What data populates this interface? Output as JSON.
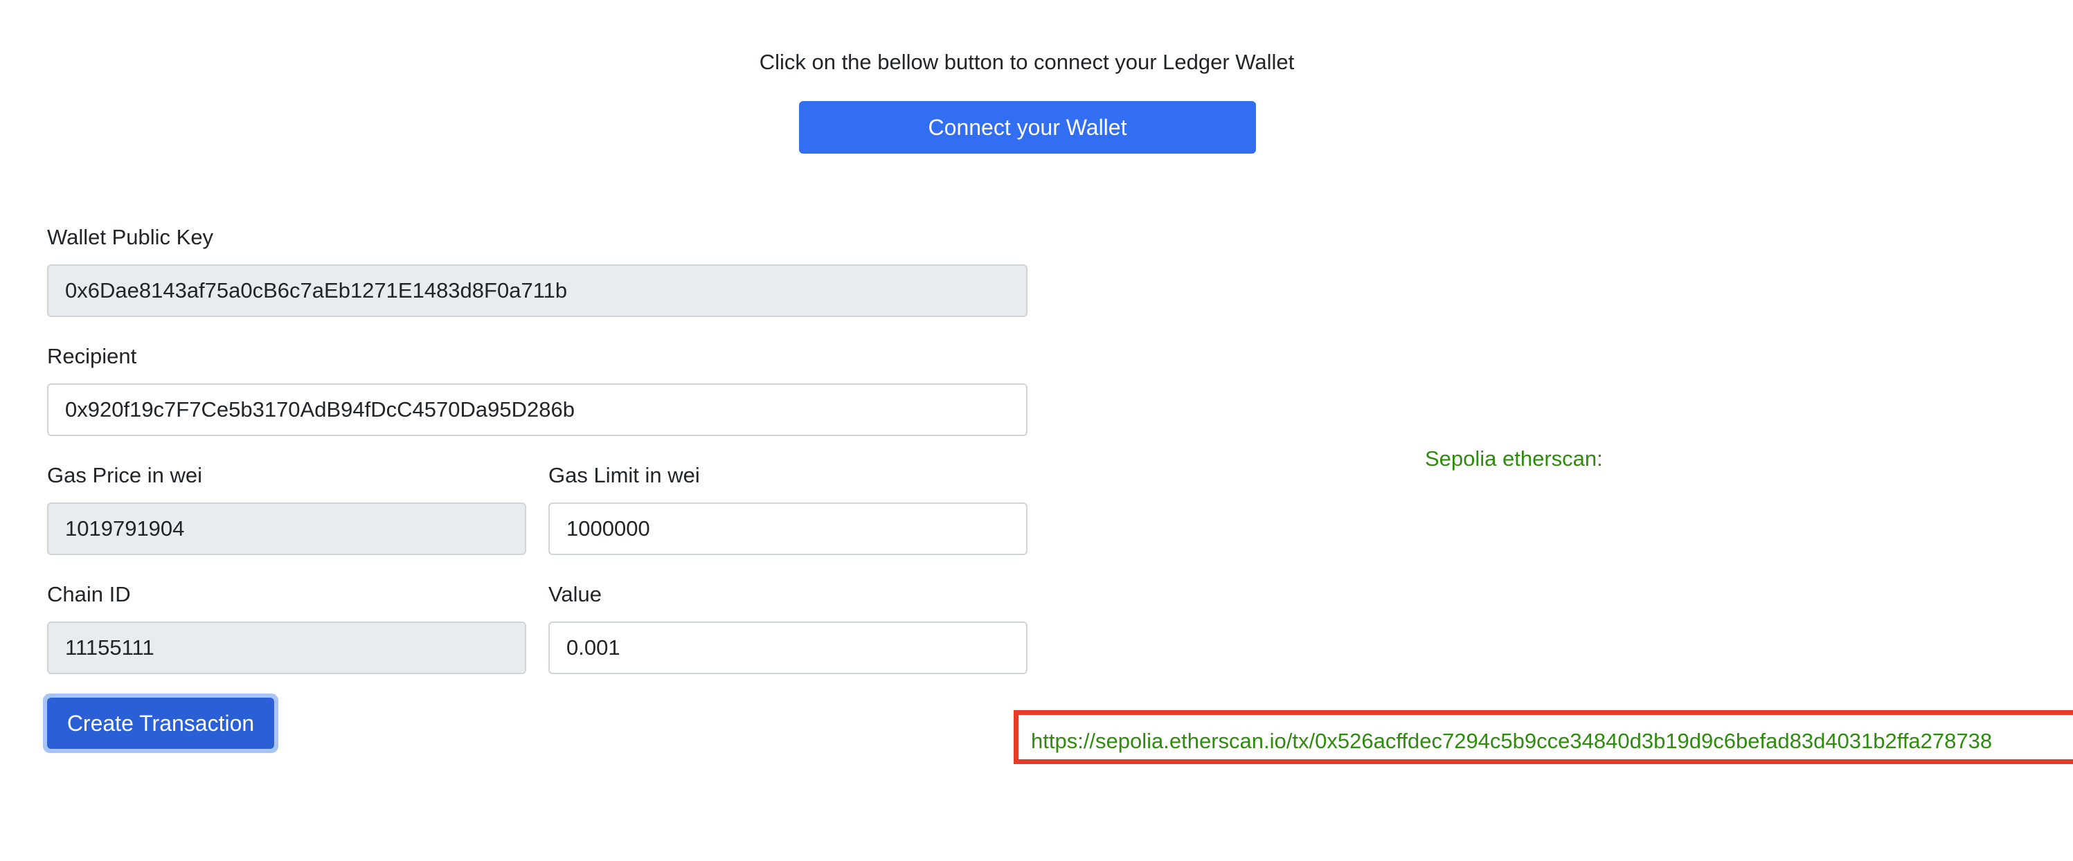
{
  "header": {
    "intro_text": "Click on the bellow button to connect your Ledger Wallet",
    "connect_button_label": "Connect your Wallet"
  },
  "form": {
    "wallet_public_key": {
      "label": "Wallet Public Key",
      "value": "0x6Dae8143af75a0cB6c7aEb1271E1483d8F0a711b"
    },
    "recipient": {
      "label": "Recipient",
      "value": "0x920f19c7F7Ce5b3170AdB94fDcC4570Da95D286b"
    },
    "gas_price": {
      "label": "Gas Price in wei",
      "value": "1019791904"
    },
    "gas_limit": {
      "label": "Gas Limit in wei",
      "value": "1000000"
    },
    "chain_id": {
      "label": "Chain ID",
      "value": "11155111"
    },
    "value": {
      "label": "Value",
      "value": "0.001"
    },
    "create_button_label": "Create Transaction"
  },
  "result": {
    "etherscan_label": "Sepolia etherscan:",
    "tx_link_text": "https://sepolia.etherscan.io/tx/0x526acffdec7294c5b9cce34840d3b19d9c6befad83d4031b2ffa278738"
  },
  "colors": {
    "primary": "#316ef2",
    "primary_active": "#2a5fd6",
    "success_text": "#2e8b0e",
    "highlight_border": "#e53b27",
    "readonly_bg": "#e9ecef"
  }
}
